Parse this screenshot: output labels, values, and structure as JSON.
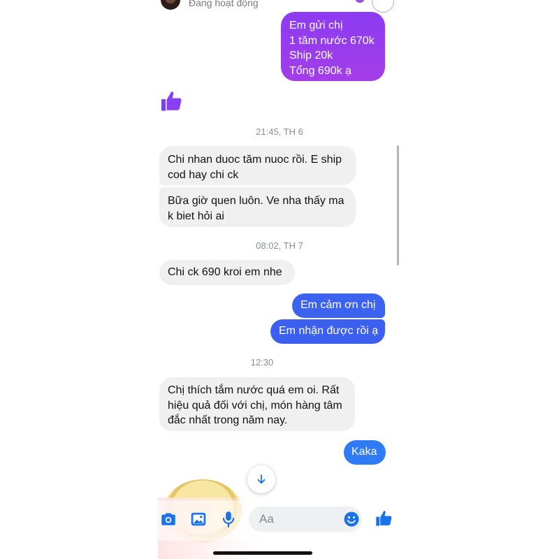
{
  "header": {
    "status": "Đang hoạt động"
  },
  "messages": {
    "m1": {
      "lines": [
        "Em gửi chị",
        "1 tăm nước 670k",
        "Ship 20k",
        "Tổng 690k ạ"
      ]
    },
    "t1": "21:45, TH 6",
    "m2": {
      "lines": [
        "Chi nhan duoc tăm nuoc rồi. E ship",
        "cod hay chi ck"
      ]
    },
    "m3": {
      "lines": [
        "Bữa giờ quen luôn. Ve nha thấy ma",
        "k biet hỏi ai"
      ]
    },
    "t2": "08:02, TH 7",
    "m4": "Chi ck 690 kroi em nhe",
    "m5": "Em cảm ơn chị",
    "m6": "Em nhận được rồi ạ",
    "t3": "12:30",
    "m7": {
      "lines": [
        "Chị thích tắm nước quá em oi. Rất",
        "hiệu quả đối với chị, món hàng tâm",
        "đắc nhất trong năm nay."
      ]
    },
    "m8": "Kaka"
  },
  "composer": {
    "placeholder": "Aa"
  },
  "icons": {
    "like_sent": "thumbs-up-icon",
    "camera": "camera-icon",
    "gallery": "image-icon",
    "mic": "microphone-icon",
    "emoji": "emoji-icon",
    "like": "thumbs-up-icon",
    "scroll_down": "arrow-down-icon"
  },
  "colors": {
    "purple_bubble": "#9a3ff0",
    "blue_bubble": "#3c67f0",
    "kaka_bubble": "#2f7bf5",
    "incoming_bubble": "#f0f0f0",
    "accent": "#1a73e8"
  }
}
